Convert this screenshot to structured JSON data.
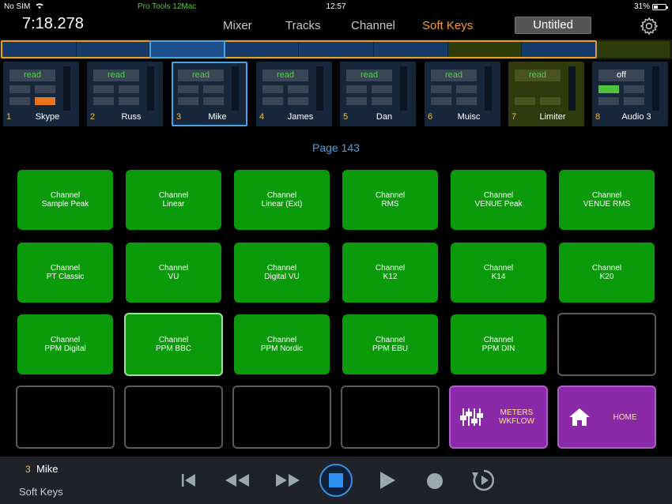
{
  "status": {
    "carrier": "No SIM",
    "app_name": "Pro Tools 12Mac",
    "clock": "12:57",
    "battery": "31%"
  },
  "header": {
    "timecode": "7:18.278",
    "tabs": [
      {
        "label": "Mixer"
      },
      {
        "label": "Tracks"
      },
      {
        "label": "Channel"
      },
      {
        "label": "Soft Keys"
      }
    ],
    "active_tab": "Soft Keys",
    "session": "Untitled"
  },
  "channels": [
    {
      "num": "1",
      "name": "Skype",
      "auto": "read"
    },
    {
      "num": "2",
      "name": "Russ",
      "auto": "read"
    },
    {
      "num": "3",
      "name": "Mike",
      "auto": "read"
    },
    {
      "num": "4",
      "name": "James",
      "auto": "read"
    },
    {
      "num": "5",
      "name": "Dan",
      "auto": "read"
    },
    {
      "num": "6",
      "name": "Muisc",
      "auto": "read"
    },
    {
      "num": "7",
      "name": "Limiter",
      "auto": "read"
    },
    {
      "num": "8",
      "name": "Audio 3",
      "auto": "off"
    }
  ],
  "page_label": "Page 143",
  "keys": [
    {
      "line1": "Channel",
      "line2": "Sample Peak"
    },
    {
      "line1": "Channel",
      "line2": "Linear"
    },
    {
      "line1": "Channel",
      "line2": "Linear (Ext)"
    },
    {
      "line1": "Channel",
      "line2": "RMS"
    },
    {
      "line1": "Channel",
      "line2": "VENUE Peak"
    },
    {
      "line1": "Channel",
      "line2": "VENUE RMS"
    },
    {
      "line1": "Channel",
      "line2": "PT Classic"
    },
    {
      "line1": "Channel",
      "line2": "VU"
    },
    {
      "line1": "Channel",
      "line2": "Digital VU"
    },
    {
      "line1": "Channel",
      "line2": "K12"
    },
    {
      "line1": "Channel",
      "line2": "K14"
    },
    {
      "line1": "Channel",
      "line2": "K20"
    },
    {
      "line1": "Channel",
      "line2": "PPM Digital"
    },
    {
      "line1": "Channel",
      "line2": "PPM BBC"
    },
    {
      "line1": "Channel",
      "line2": "PPM Nordic"
    },
    {
      "line1": "Channel",
      "line2": "PPM EBU"
    },
    {
      "line1": "Channel",
      "line2": "PPM DIN"
    },
    {
      "line1": "",
      "line2": ""
    },
    {
      "line1": "",
      "line2": ""
    },
    {
      "line1": "",
      "line2": ""
    },
    {
      "line1": "",
      "line2": ""
    },
    {
      "line1": "",
      "line2": ""
    },
    {
      "line1": "METERS",
      "line2": "WKFLOW",
      "icon": "meters-icon"
    },
    {
      "line1": "HOME",
      "line2": "",
      "icon": "home-icon"
    }
  ],
  "footer": {
    "selected_num": "3",
    "selected_name": "Mike",
    "mode": "Soft Keys"
  },
  "colors": {
    "accent_orange": "#f39a2a",
    "accent_blue": "#48a2e6",
    "key_green": "#0a9a0a",
    "key_purple": "#8a2aa8",
    "automation_green": "#4fd14f"
  }
}
